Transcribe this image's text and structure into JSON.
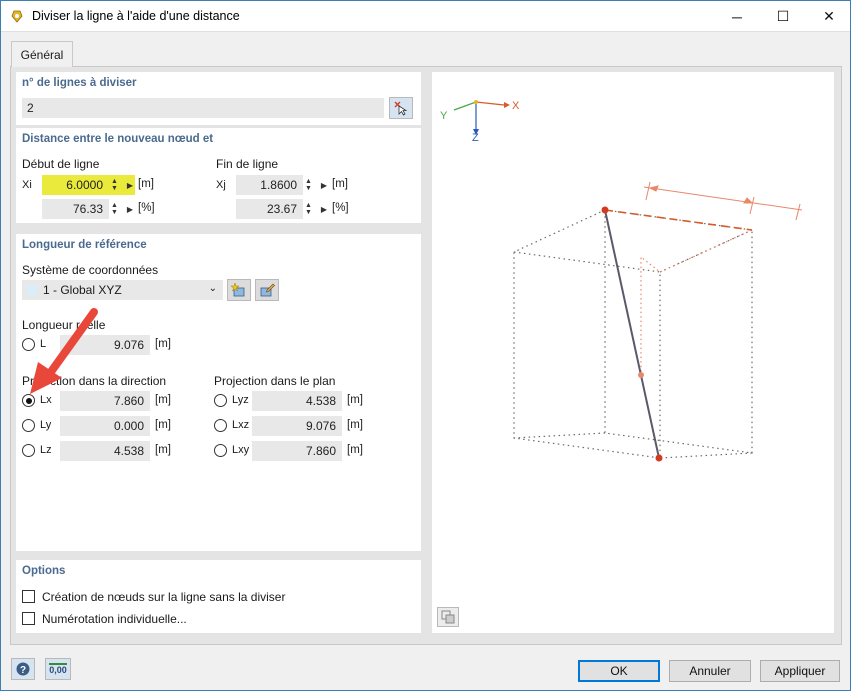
{
  "window": {
    "title": "Diviser la ligne à l'aide d'une distance",
    "min_glyph": "─",
    "max_glyph": "☐",
    "close_glyph": "✕"
  },
  "tabs": [
    {
      "label": "Général"
    }
  ],
  "lines_group": {
    "title": "n° de lignes à diviser",
    "value": "2"
  },
  "distance_group": {
    "title": "Distance entre le nouveau nœud et",
    "start_label": "Début de ligne",
    "end_label": "Fin de ligne",
    "xi_label": "Xi",
    "xj_label": "Xj",
    "xi_value": "6.0000",
    "xi_unit": "[m]",
    "xi_pct": "76.33",
    "xi_pct_unit": "[%]",
    "xj_value": "1.8600",
    "xj_unit": "[m]",
    "xj_pct": "23.67",
    "xj_pct_unit": "[%]"
  },
  "reference_group": {
    "title": "Longueur de référence",
    "cs_label": "Système de coordonnées",
    "cs_value": "1 - Global XYZ",
    "real_length_label": "Longueur réelle",
    "L_label": "L",
    "L_value": "9.076",
    "L_unit": "[m]",
    "direction_label": "Projection dans la direction",
    "plane_label": "Projection dans le plan",
    "Lx_label": "Lx",
    "Lx_value": "7.860",
    "Lx_unit": "[m]",
    "Ly_label": "Ly",
    "Ly_value": "0.000",
    "Ly_unit": "[m]",
    "Lz_label": "Lz",
    "Lz_value": "4.538",
    "Lz_unit": "[m]",
    "Lyz_label": "Lyz",
    "Lyz_value": "4.538",
    "Lyz_unit": "[m]",
    "Lxz_label": "Lxz",
    "Lxz_value": "9.076",
    "Lxz_unit": "[m]",
    "Lxy_label": "Lxy",
    "Lxy_value": "7.860",
    "Lxy_unit": "[m]",
    "selected": "Lx"
  },
  "options_group": {
    "title": "Options",
    "opt1": "Création de nœuds sur la ligne sans la diviser",
    "opt2": "Numérotation individuelle..."
  },
  "preview": {
    "axis_x": "X",
    "axis_y": "Y",
    "axis_z": "Z"
  },
  "footer": {
    "ok": "OK",
    "cancel": "Annuler",
    "apply": "Appliquer",
    "units_label": "0,00"
  },
  "colors": {
    "group_title": "#4a6a8f",
    "highlight": "#eaea3c",
    "arrow": "#e8473a",
    "node": "#d33a1f",
    "dim": "#e8886a"
  }
}
